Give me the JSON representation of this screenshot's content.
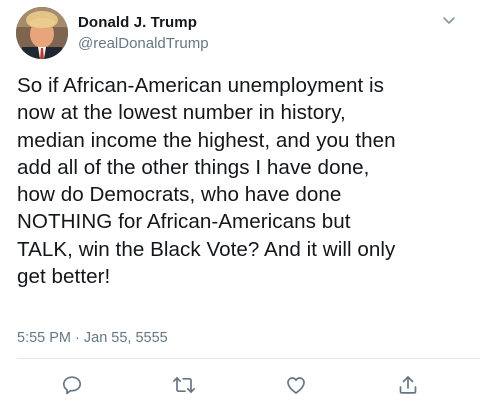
{
  "user": {
    "display_name": "Donald J. Trump",
    "handle": "@realDonaldTrump",
    "avatar_icon": "profile-photo"
  },
  "tweet": {
    "text": "So if African-American unemployment is\nnow at the lowest number in history,\nmedian income the highest, and you then\nadd all of the other things I have done,\nhow do Democrats, who have done\nNOTHING for African-Americans but\nTALK, win the Black Vote? And it will only\nget better!",
    "timestamp": "5:55 PM · Jan 55, 5555"
  },
  "actions": [
    {
      "icon": "reply-icon"
    },
    {
      "icon": "retweet-icon"
    },
    {
      "icon": "like-icon"
    },
    {
      "icon": "share-icon"
    }
  ],
  "colors": {
    "text": "#14171a",
    "secondary": "#657786",
    "icon": "#657786",
    "divider": "#e1e8ed"
  }
}
